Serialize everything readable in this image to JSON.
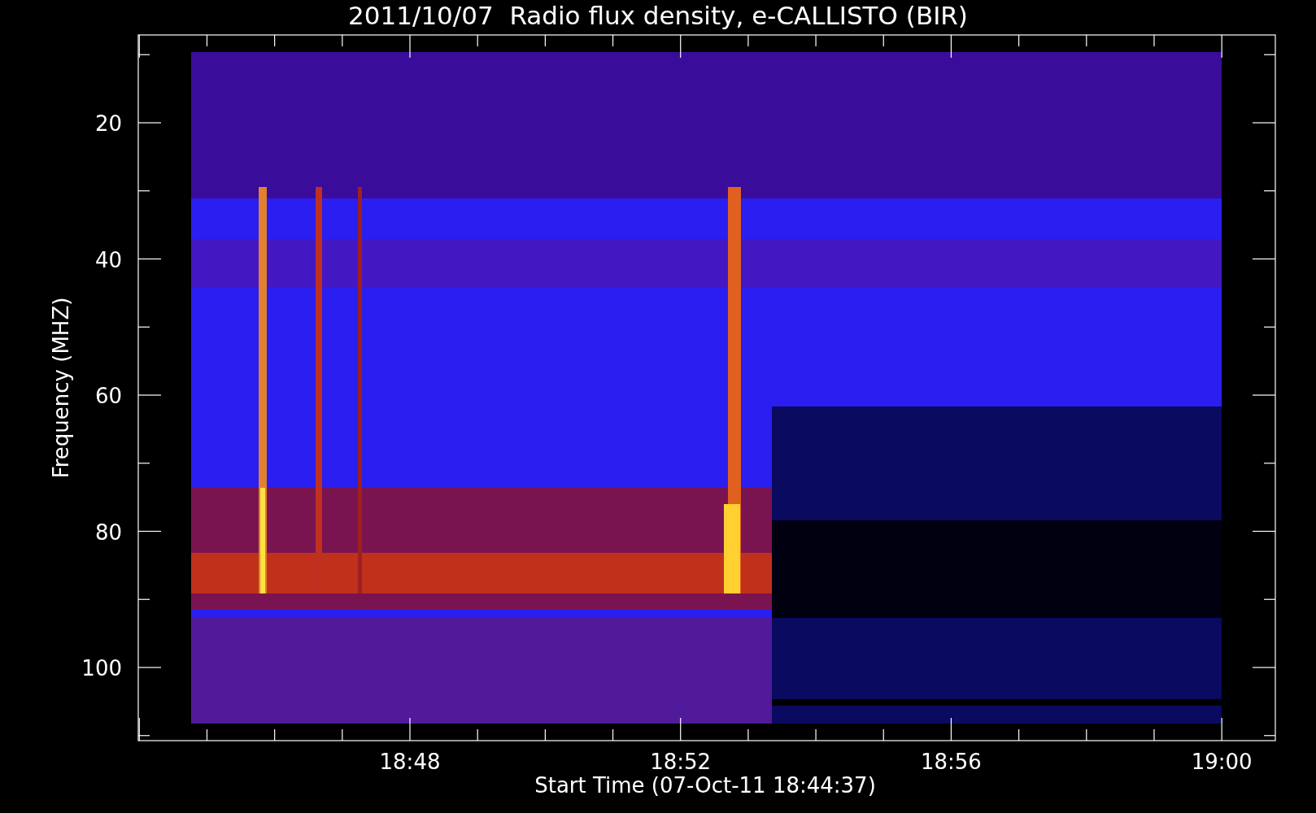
{
  "title": "2011/10/07  Radio flux density, e-CALLISTO (BIR)",
  "y_axis": {
    "label": "Frequency (MHZ)",
    "ticks": [
      "20",
      "40",
      "60",
      "80",
      "100"
    ]
  },
  "x_axis": {
    "label": "Start Time (07-Oct-11 18:44:37)",
    "ticks": [
      "18:48",
      "18:52",
      "18:56",
      "19:00"
    ]
  }
}
